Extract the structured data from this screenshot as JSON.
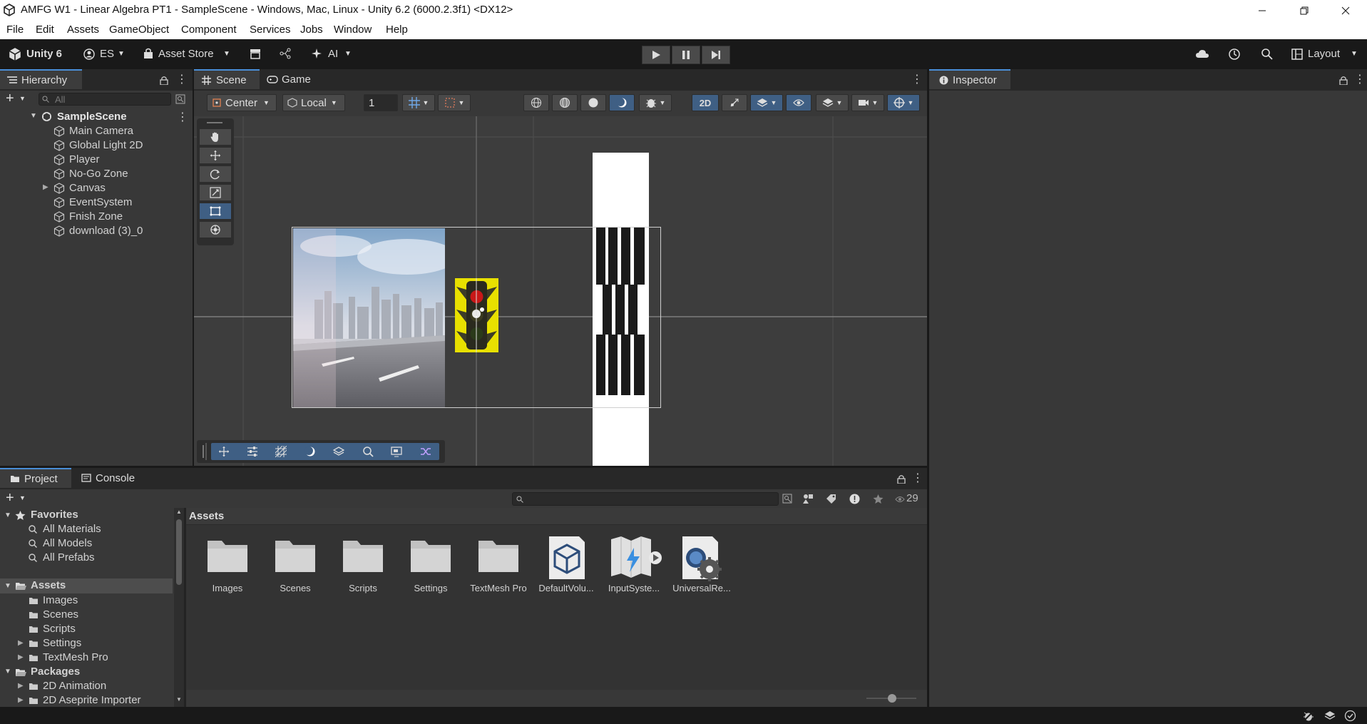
{
  "window": {
    "title": "AMFG W1 - Linear Algebra PT1 - SampleScene - Windows, Mac, Linux - Unity 6.2 (6000.2.3f1) <DX12>"
  },
  "menu": [
    "File",
    "Edit",
    "Assets",
    "GameObject",
    "Component",
    "Services",
    "Jobs",
    "Window",
    "Help"
  ],
  "toolbar": {
    "unity_label": "Unity 6",
    "account_label": "ES",
    "asset_store_label": "Asset Store",
    "ai_label": "AI",
    "layout_label": "Layout"
  },
  "hierarchy": {
    "tab_label": "Hierarchy",
    "search_placeholder": "All",
    "scene_name": "SampleScene",
    "items": [
      "Main Camera",
      "Global Light 2D",
      "Player",
      "No-Go Zone",
      "Canvas",
      "EventSystem",
      "Fnish Zone",
      "download (3)_0"
    ]
  },
  "scene_view": {
    "tabs": [
      "Scene",
      "Game"
    ],
    "pivot_label": "Center",
    "space_label": "Local",
    "grid_value": "1",
    "mode_2d_label": "2D"
  },
  "inspector": {
    "tab_label": "Inspector"
  },
  "project": {
    "tabs": [
      "Project",
      "Console"
    ],
    "breadcrumb": "Assets",
    "visible_count": "29",
    "favorites_label": "Favorites",
    "favorites": [
      "All Materials",
      "All Models",
      "All Prefabs"
    ],
    "assets_label": "Assets",
    "asset_folders": [
      "Images",
      "Scenes",
      "Scripts",
      "Settings",
      "TextMesh Pro"
    ],
    "packages_label": "Packages",
    "packages": [
      "2D Animation",
      "2D Aseprite Importer"
    ],
    "grid_items": [
      {
        "label": "Images",
        "icon": "folder-icon"
      },
      {
        "label": "Scenes",
        "icon": "folder-icon"
      },
      {
        "label": "Scripts",
        "icon": "folder-icon"
      },
      {
        "label": "Settings",
        "icon": "folder-icon"
      },
      {
        "label": "TextMesh Pro",
        "icon": "folder-icon"
      },
      {
        "label": "DefaultVolu...",
        "icon": "volume-profile-icon"
      },
      {
        "label": "InputSyste...",
        "icon": "input-actions-icon"
      },
      {
        "label": "UniversalRe...",
        "icon": "render-pipeline-icon"
      }
    ]
  },
  "colors": {
    "accent": "#4a8fd8",
    "panel": "#383838",
    "toolbar": "#191919",
    "active_button": "#3f5f84"
  }
}
